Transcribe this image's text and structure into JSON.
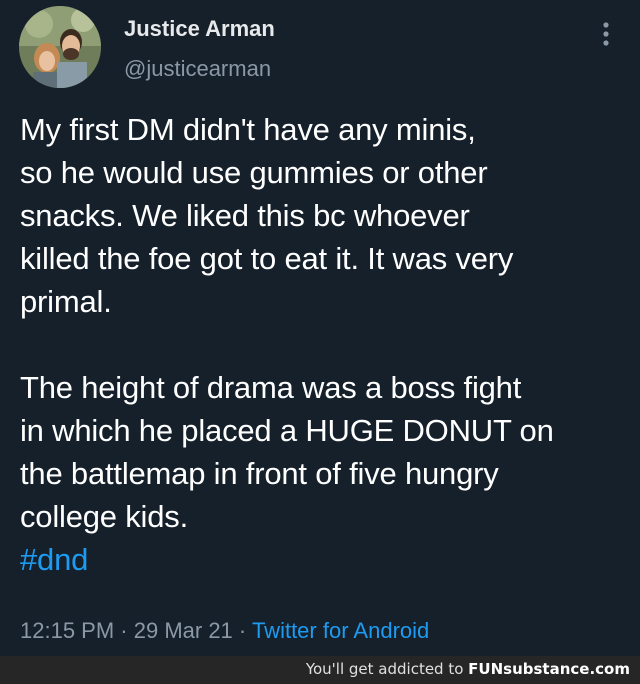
{
  "tweet": {
    "author": {
      "display_name": "Justice Arman",
      "handle": "@justicearman"
    },
    "paragraphs": [
      [
        "My first DM didn't have any minis,",
        "so he would use gummies or other",
        "snacks. We liked this bc whoever",
        "killed the foe got to eat it. It was very",
        "primal."
      ],
      [
        "The height of drama was a boss fight",
        "in which he placed a HUGE DONUT on",
        "the battlemap in front of five hungry",
        "college kids."
      ]
    ],
    "hashtag": "#dnd",
    "meta": {
      "time": "12:15 PM",
      "separator": " · ",
      "date": "29 Mar 21",
      "source": "Twitter for Android"
    },
    "icons": {
      "more": "vertical-ellipsis-icon",
      "avatar": "profile-photo"
    },
    "colors": {
      "background": "#15202b",
      "text": "#ffffff",
      "secondary": "#8b98a5",
      "link": "#1d9bf0"
    }
  },
  "watermark": {
    "tagline": "You'll get addicted to ",
    "brand_prefix": "FUN",
    "brand_main": "substance",
    "brand_tld": ".com"
  }
}
